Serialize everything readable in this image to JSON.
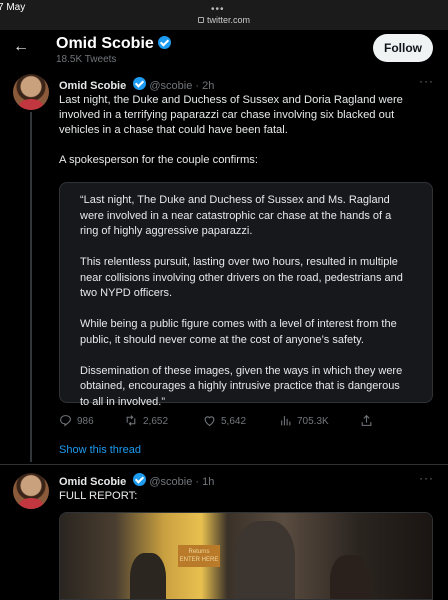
{
  "status_bar": {
    "time": "7 May",
    "dots": "•••",
    "url": "twitter.com"
  },
  "header": {
    "name": "Omid Scobie",
    "tweets_count": "18.5K Tweets",
    "follow_label": "Follow"
  },
  "tweet": {
    "name": "Omid Scobie",
    "handle": "@scobie",
    "time": "· 2h",
    "text_1": "Last night, the Duke and Duchess of Sussex and Doria Ragland were involved in a terrifying paparazzi car chase involving six blacked out vehicles in a chase that could have been fatal.",
    "text_2": "A spokesperson for the couple confirms:",
    "quote": [
      "“Last night, The Duke and Duchess of Sussex and Ms. Ragland were involved in a near catastrophic car chase at the hands of a ring of highly aggressive paparazzi.",
      "This relentless pursuit, lasting over two hours, resulted in multiple near collisions involving other drivers on the road, pedestrians and two NYPD officers.",
      "While being a public figure comes with a level of interest from the public, it should never come at the cost of anyone’s safety.",
      "Dissemination of these images, given the ways in which they were obtained, encourages a highly intrusive practice that is dangerous to all in involved.”"
    ],
    "replies": "986",
    "retweets": "2,652",
    "likes": "5,642",
    "views": "705.3K",
    "show_thread": "Show this thread"
  },
  "tweet2": {
    "name": "Omid Scobie",
    "handle": "@scobie",
    "time": "· 1h",
    "text": "FULL REPORT:",
    "media_sign": "Returns ENTER HERE"
  },
  "colors": {
    "accent": "#1d9bf0",
    "background": "#000000",
    "muted": "#71767b"
  }
}
